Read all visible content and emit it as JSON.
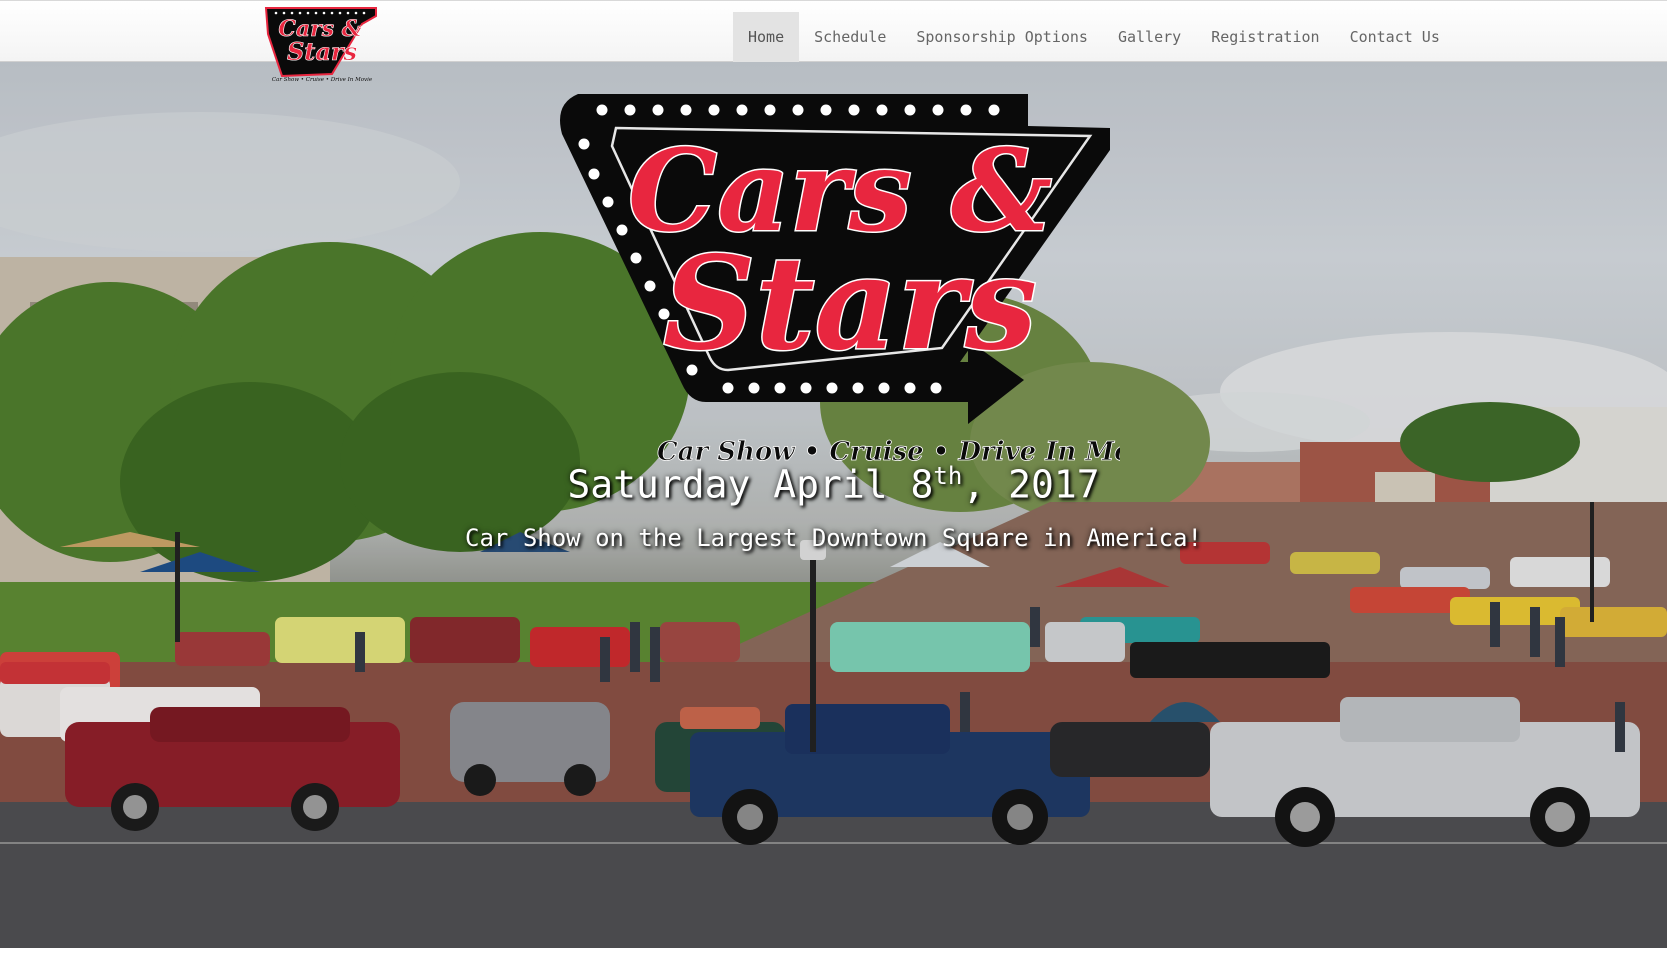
{
  "nav": {
    "items": [
      {
        "label": "Home",
        "active": true
      },
      {
        "label": "Schedule",
        "active": false
      },
      {
        "label": "Sponsorship Options",
        "active": false
      },
      {
        "label": "Gallery",
        "active": false
      },
      {
        "label": "Registration",
        "active": false
      },
      {
        "label": "Contact Us",
        "active": false
      }
    ]
  },
  "logo": {
    "text_top": "Cars &",
    "text_bottom": "Stars",
    "subtitle": "Car Show • Cruise • Drive In Movie"
  },
  "hero": {
    "date_main": "Saturday April 8",
    "date_suffix": "th",
    "date_year": ", 2017",
    "tagline": "Car Show on the Largest Downtown Square in America!"
  },
  "colors": {
    "logo_red": "#e8263f",
    "logo_black": "#0a0a0a",
    "nav_text": "#666666",
    "nav_active_bg": "#e3e3e3"
  }
}
